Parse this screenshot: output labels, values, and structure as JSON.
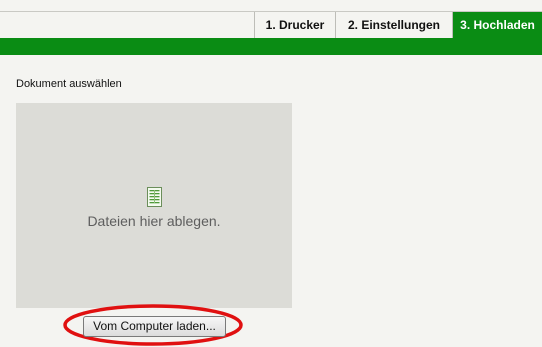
{
  "tabs": [
    {
      "label": "1. Drucker",
      "active": false
    },
    {
      "label": "2. Einstellungen",
      "active": false
    },
    {
      "label": "3. Hochladen",
      "active": true
    }
  ],
  "colors": {
    "accent": "#0a8c14",
    "highlight": "#e01010",
    "dropzone": "#dcdcd7"
  },
  "upload": {
    "section_label": "Dokument auswählen",
    "drop_text": "Dateien hier ablegen.",
    "drop_icon": "document-icon",
    "button_label": "Vom Computer laden..."
  }
}
